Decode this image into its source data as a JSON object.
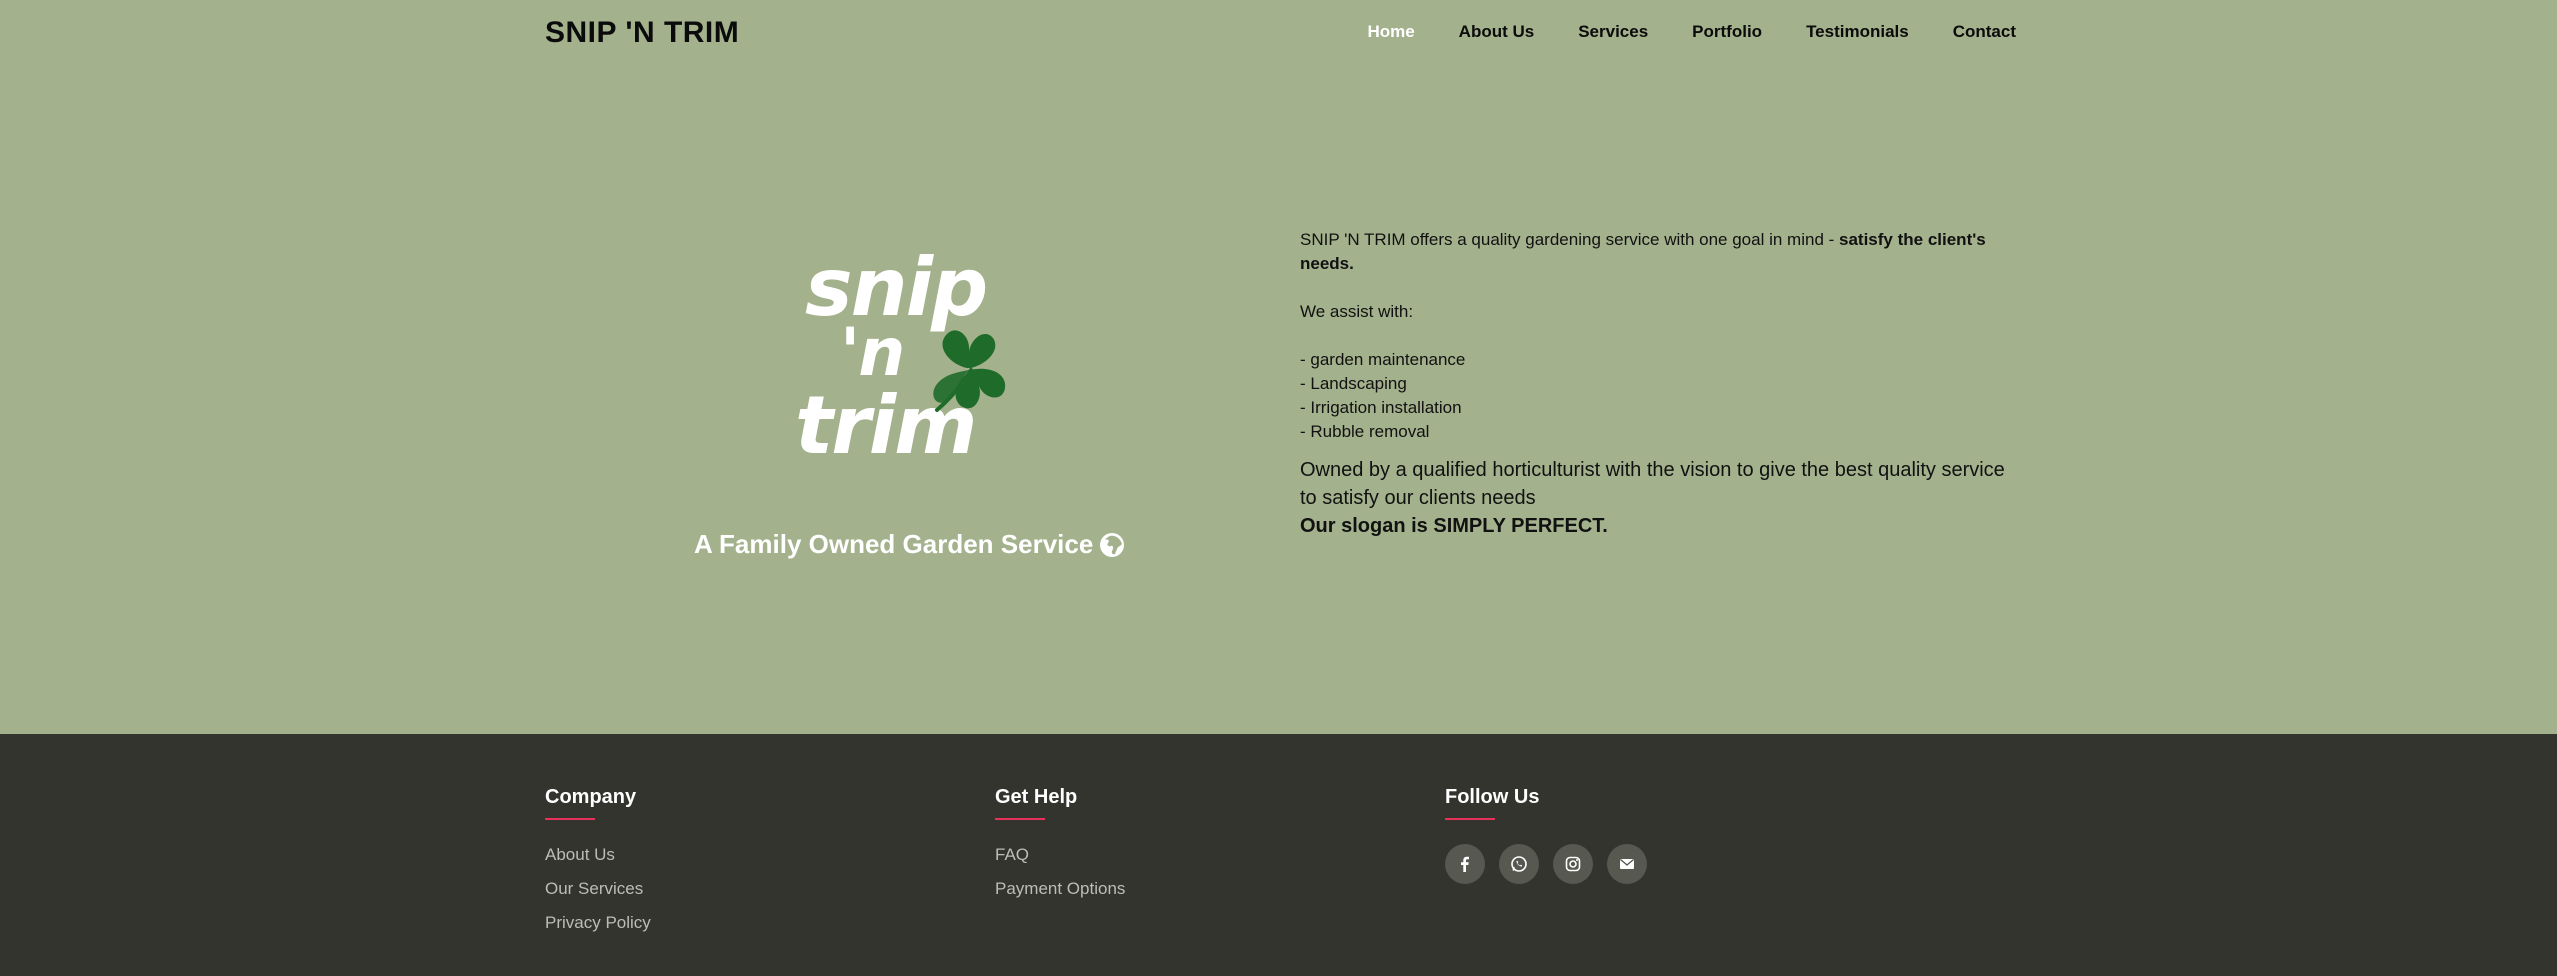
{
  "header": {
    "brand": "SNIP 'N TRIM",
    "nav": [
      {
        "label": "Home",
        "active": true
      },
      {
        "label": "About Us"
      },
      {
        "label": "Services"
      },
      {
        "label": "Portfolio"
      },
      {
        "label": "Testimonials"
      },
      {
        "label": "Contact"
      }
    ]
  },
  "hero": {
    "logo_text": [
      "snip",
      "'n",
      "trim"
    ],
    "tagline": "A Family Owned Garden Service",
    "intro": "SNIP 'N TRIM offers a quality gardening service with one goal in mind - ",
    "intro_bold": "satisfy the client's needs.",
    "assist_heading": "We assist with:",
    "services": [
      "- garden maintenance",
      "- Landscaping",
      "- Irrigation installation",
      "- Rubble removal"
    ],
    "vision": "Owned by a qualified horticulturist with the vision to give the best quality service to satisfy our clients needs",
    "slogan": "Our slogan is SIMPLY PERFECT."
  },
  "footer": {
    "company": {
      "title": "Company",
      "links": [
        "About Us",
        "Our Services",
        "Privacy Policy"
      ]
    },
    "help": {
      "title": "Get Help",
      "links": [
        "FAQ",
        "Payment Options"
      ]
    },
    "follow": {
      "title": "Follow Us",
      "icons": [
        "facebook-icon",
        "whatsapp-icon",
        "instagram-icon",
        "envelope-icon"
      ]
    }
  },
  "colors": {
    "background": "#a3b18c",
    "footer": "#32342d",
    "accent_underline": "#e8315a",
    "clover": "#1f6b2a"
  }
}
